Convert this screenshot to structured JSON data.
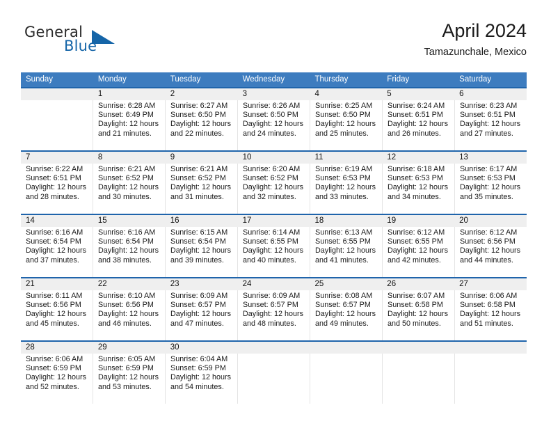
{
  "brand": {
    "name_part1": "General",
    "name_part2": "Blue",
    "logo_icon": "triangle-logo-icon"
  },
  "header": {
    "title": "April 2024",
    "subtitle": "Tamazunchale, Mexico"
  },
  "colors": {
    "header_blue": "#3d7cbf",
    "divider_blue": "#1f64ab",
    "brand_blue": "#1565a8",
    "number_band": "#efefef"
  },
  "weekday_headers": [
    "Sunday",
    "Monday",
    "Tuesday",
    "Wednesday",
    "Thursday",
    "Friday",
    "Saturday"
  ],
  "weeks": [
    {
      "days": [
        {
          "num": "",
          "l1": "",
          "l2": "",
          "l3": "",
          "l4": ""
        },
        {
          "num": "1",
          "l1": "Sunrise: 6:28 AM",
          "l2": "Sunset: 6:49 PM",
          "l3": "Daylight: 12 hours",
          "l4": "and 21 minutes."
        },
        {
          "num": "2",
          "l1": "Sunrise: 6:27 AM",
          "l2": "Sunset: 6:50 PM",
          "l3": "Daylight: 12 hours",
          "l4": "and 22 minutes."
        },
        {
          "num": "3",
          "l1": "Sunrise: 6:26 AM",
          "l2": "Sunset: 6:50 PM",
          "l3": "Daylight: 12 hours",
          "l4": "and 24 minutes."
        },
        {
          "num": "4",
          "l1": "Sunrise: 6:25 AM",
          "l2": "Sunset: 6:50 PM",
          "l3": "Daylight: 12 hours",
          "l4": "and 25 minutes."
        },
        {
          "num": "5",
          "l1": "Sunrise: 6:24 AM",
          "l2": "Sunset: 6:51 PM",
          "l3": "Daylight: 12 hours",
          "l4": "and 26 minutes."
        },
        {
          "num": "6",
          "l1": "Sunrise: 6:23 AM",
          "l2": "Sunset: 6:51 PM",
          "l3": "Daylight: 12 hours",
          "l4": "and 27 minutes."
        }
      ]
    },
    {
      "days": [
        {
          "num": "7",
          "l1": "Sunrise: 6:22 AM",
          "l2": "Sunset: 6:51 PM",
          "l3": "Daylight: 12 hours",
          "l4": "and 28 minutes."
        },
        {
          "num": "8",
          "l1": "Sunrise: 6:21 AM",
          "l2": "Sunset: 6:52 PM",
          "l3": "Daylight: 12 hours",
          "l4": "and 30 minutes."
        },
        {
          "num": "9",
          "l1": "Sunrise: 6:21 AM",
          "l2": "Sunset: 6:52 PM",
          "l3": "Daylight: 12 hours",
          "l4": "and 31 minutes."
        },
        {
          "num": "10",
          "l1": "Sunrise: 6:20 AM",
          "l2": "Sunset: 6:52 PM",
          "l3": "Daylight: 12 hours",
          "l4": "and 32 minutes."
        },
        {
          "num": "11",
          "l1": "Sunrise: 6:19 AM",
          "l2": "Sunset: 6:53 PM",
          "l3": "Daylight: 12 hours",
          "l4": "and 33 minutes."
        },
        {
          "num": "12",
          "l1": "Sunrise: 6:18 AM",
          "l2": "Sunset: 6:53 PM",
          "l3": "Daylight: 12 hours",
          "l4": "and 34 minutes."
        },
        {
          "num": "13",
          "l1": "Sunrise: 6:17 AM",
          "l2": "Sunset: 6:53 PM",
          "l3": "Daylight: 12 hours",
          "l4": "and 35 minutes."
        }
      ]
    },
    {
      "days": [
        {
          "num": "14",
          "l1": "Sunrise: 6:16 AM",
          "l2": "Sunset: 6:54 PM",
          "l3": "Daylight: 12 hours",
          "l4": "and 37 minutes."
        },
        {
          "num": "15",
          "l1": "Sunrise: 6:16 AM",
          "l2": "Sunset: 6:54 PM",
          "l3": "Daylight: 12 hours",
          "l4": "and 38 minutes."
        },
        {
          "num": "16",
          "l1": "Sunrise: 6:15 AM",
          "l2": "Sunset: 6:54 PM",
          "l3": "Daylight: 12 hours",
          "l4": "and 39 minutes."
        },
        {
          "num": "17",
          "l1": "Sunrise: 6:14 AM",
          "l2": "Sunset: 6:55 PM",
          "l3": "Daylight: 12 hours",
          "l4": "and 40 minutes."
        },
        {
          "num": "18",
          "l1": "Sunrise: 6:13 AM",
          "l2": "Sunset: 6:55 PM",
          "l3": "Daylight: 12 hours",
          "l4": "and 41 minutes."
        },
        {
          "num": "19",
          "l1": "Sunrise: 6:12 AM",
          "l2": "Sunset: 6:55 PM",
          "l3": "Daylight: 12 hours",
          "l4": "and 42 minutes."
        },
        {
          "num": "20",
          "l1": "Sunrise: 6:12 AM",
          "l2": "Sunset: 6:56 PM",
          "l3": "Daylight: 12 hours",
          "l4": "and 44 minutes."
        }
      ]
    },
    {
      "days": [
        {
          "num": "21",
          "l1": "Sunrise: 6:11 AM",
          "l2": "Sunset: 6:56 PM",
          "l3": "Daylight: 12 hours",
          "l4": "and 45 minutes."
        },
        {
          "num": "22",
          "l1": "Sunrise: 6:10 AM",
          "l2": "Sunset: 6:56 PM",
          "l3": "Daylight: 12 hours",
          "l4": "and 46 minutes."
        },
        {
          "num": "23",
          "l1": "Sunrise: 6:09 AM",
          "l2": "Sunset: 6:57 PM",
          "l3": "Daylight: 12 hours",
          "l4": "and 47 minutes."
        },
        {
          "num": "24",
          "l1": "Sunrise: 6:09 AM",
          "l2": "Sunset: 6:57 PM",
          "l3": "Daylight: 12 hours",
          "l4": "and 48 minutes."
        },
        {
          "num": "25",
          "l1": "Sunrise: 6:08 AM",
          "l2": "Sunset: 6:57 PM",
          "l3": "Daylight: 12 hours",
          "l4": "and 49 minutes."
        },
        {
          "num": "26",
          "l1": "Sunrise: 6:07 AM",
          "l2": "Sunset: 6:58 PM",
          "l3": "Daylight: 12 hours",
          "l4": "and 50 minutes."
        },
        {
          "num": "27",
          "l1": "Sunrise: 6:06 AM",
          "l2": "Sunset: 6:58 PM",
          "l3": "Daylight: 12 hours",
          "l4": "and 51 minutes."
        }
      ]
    },
    {
      "days": [
        {
          "num": "28",
          "l1": "Sunrise: 6:06 AM",
          "l2": "Sunset: 6:59 PM",
          "l3": "Daylight: 12 hours",
          "l4": "and 52 minutes."
        },
        {
          "num": "29",
          "l1": "Sunrise: 6:05 AM",
          "l2": "Sunset: 6:59 PM",
          "l3": "Daylight: 12 hours",
          "l4": "and 53 minutes."
        },
        {
          "num": "30",
          "l1": "Sunrise: 6:04 AM",
          "l2": "Sunset: 6:59 PM",
          "l3": "Daylight: 12 hours",
          "l4": "and 54 minutes."
        },
        {
          "num": "",
          "l1": "",
          "l2": "",
          "l3": "",
          "l4": ""
        },
        {
          "num": "",
          "l1": "",
          "l2": "",
          "l3": "",
          "l4": ""
        },
        {
          "num": "",
          "l1": "",
          "l2": "",
          "l3": "",
          "l4": ""
        },
        {
          "num": "",
          "l1": "",
          "l2": "",
          "l3": "",
          "l4": ""
        }
      ]
    }
  ]
}
